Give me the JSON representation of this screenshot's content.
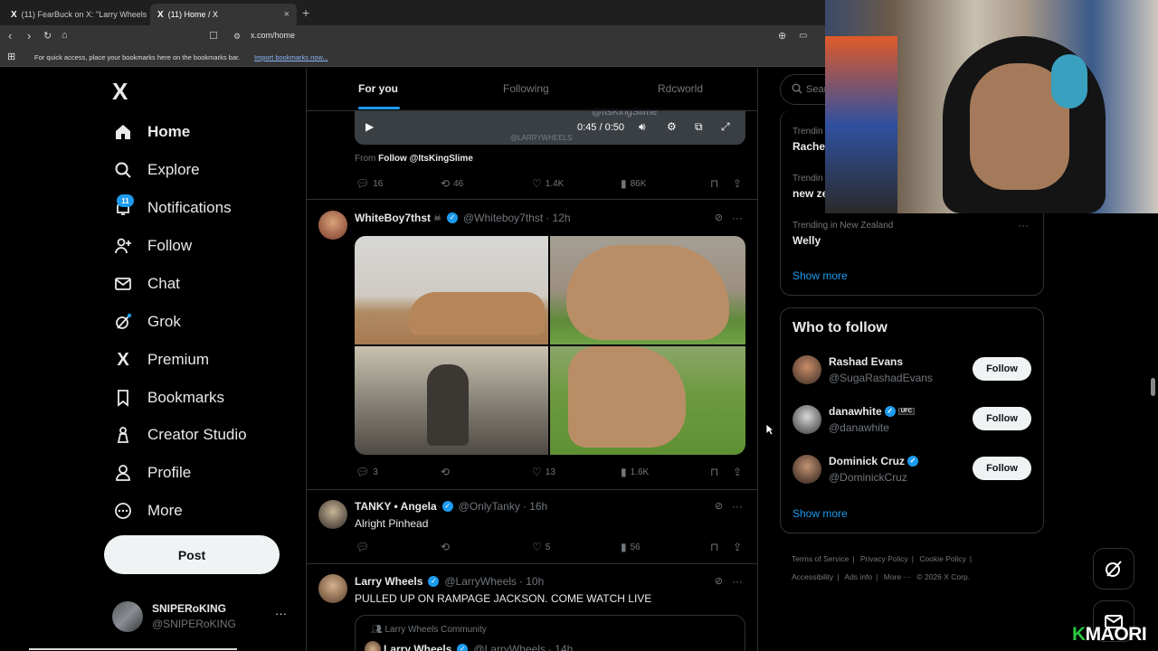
{
  "browser": {
    "tabs": [
      {
        "icon": "X",
        "title": "(11) FearBuck on X: \"Larry Wheels sl..."
      },
      {
        "icon": "X",
        "title": "(11) Home / X"
      }
    ],
    "new_tab": "+",
    "close": "×",
    "url": "x.com/home",
    "bookmarks_text": "For quick access, place your bookmarks here on the bookmarks bar.",
    "bookmarks_link": "Import bookmarks now..."
  },
  "nav": {
    "logo": "X",
    "items": [
      {
        "label": "Home",
        "icon": "home-icon"
      },
      {
        "label": "Explore",
        "icon": "search-icon"
      },
      {
        "label": "Notifications",
        "icon": "bell-icon",
        "badge": "11"
      },
      {
        "label": "Follow",
        "icon": "person-plus-icon"
      },
      {
        "label": "Chat",
        "icon": "mail-icon"
      },
      {
        "label": "Grok",
        "icon": "grok-icon"
      },
      {
        "label": "Premium",
        "icon": "x-logo-icon"
      },
      {
        "label": "Bookmarks",
        "icon": "bookmark-icon"
      },
      {
        "label": "Creator Studio",
        "icon": "creator-icon"
      },
      {
        "label": "Profile",
        "icon": "person-icon"
      },
      {
        "label": "More",
        "icon": "more-circle-icon"
      }
    ],
    "post_label": "Post",
    "account": {
      "name": "SNIPERoKING",
      "handle": "@SNIPERoKING",
      "menu": "···"
    }
  },
  "timeline": {
    "tabs": [
      "For you",
      "Following",
      "Rdcworld"
    ],
    "video": {
      "time": "0:45 / 0:50",
      "watermark": "@ItsKingSlime",
      "watermark2": "@LARRYWHEELS"
    },
    "from_prefix": "From",
    "from_link": "Follow @ItsKingSlime",
    "post0_stats": {
      "replies": "16",
      "reposts": "46",
      "likes": "1.4K",
      "views": "86K"
    },
    "posts": [
      {
        "name": "WhiteBoy7thst",
        "handle": "@Whiteboy7thst",
        "time": "· 12h",
        "text": "",
        "replies": "3",
        "reposts": "",
        "likes": "13",
        "views": "1.6K"
      },
      {
        "name": "TANKY • Angela",
        "handle": "@OnlyTanky",
        "time": "· 16h",
        "text": "Alright Pinhead",
        "replies": "",
        "reposts": "",
        "likes": "5",
        "views": "56"
      },
      {
        "name": "Larry Wheels",
        "handle": "@LarryWheels",
        "time": "· 10h",
        "text": "PULLED UP ON RAMPAGE JACKSON. COME WATCH LIVE"
      }
    ],
    "community_label": "Larry Wheels Community",
    "quoted": {
      "name": "Larry Wheels",
      "handle": "@LarryWheels",
      "time": "· 14h"
    },
    "menu": "···"
  },
  "right": {
    "search_placeholder": "Sear",
    "trends": [
      {
        "meta": "Trendin",
        "name": "Rache"
      },
      {
        "meta": "Trendin",
        "name": "new ze"
      },
      {
        "meta": "Trending in New Zealand",
        "name": "Welly"
      }
    ],
    "show_more": "Show more",
    "who_to_follow": {
      "title": "Who to follow",
      "people": [
        {
          "name": "Rashad Evans",
          "handle": "@SugaRashadEvans",
          "verified": false,
          "badge": ""
        },
        {
          "name": "danawhite",
          "handle": "@danawhite",
          "verified": true,
          "badge": "UFC"
        },
        {
          "name": "Dominick Cruz",
          "handle": "@DominickCruz",
          "verified": true,
          "badge": ""
        }
      ],
      "follow_label": "Follow",
      "show_more": "Show more"
    },
    "footer": {
      "links": [
        "Terms of Service",
        "Privacy Policy",
        "Cookie Policy",
        "Accessibility",
        "Ads info",
        "More ···"
      ],
      "copyright": "© 2026 X Corp."
    }
  },
  "overlay": {
    "brand_k": "K",
    "brand_text": "MAORI"
  },
  "colors": {
    "accent": "#1d9bf0",
    "bg": "#000000",
    "border": "#2f3336",
    "muted": "#71767b"
  }
}
